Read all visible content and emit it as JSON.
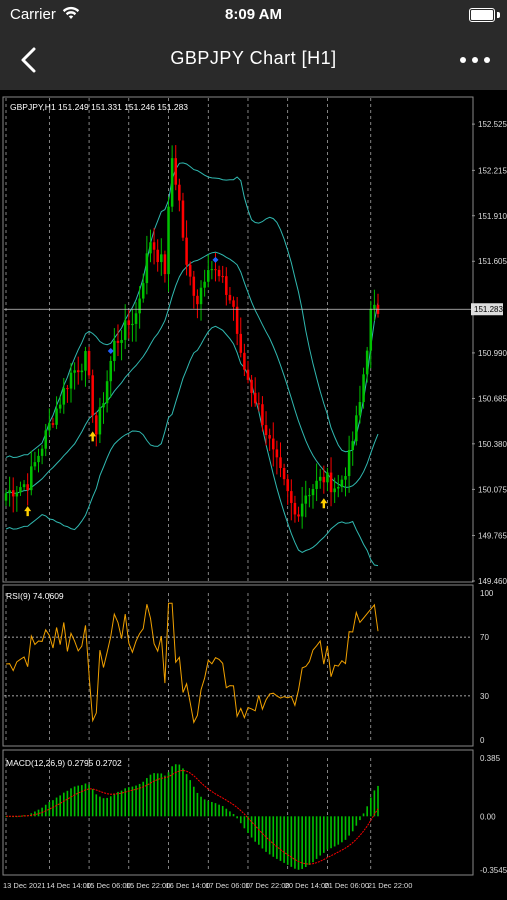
{
  "status_bar": {
    "carrier": "Carrier",
    "time": "8:09 AM"
  },
  "nav": {
    "title": "GBPJPY Chart [H1]"
  },
  "chart_data": [
    {
      "type": "candlestick",
      "title": "GBPJPY,H1  151.249 151.331 151.246 151.283",
      "price_ticks": [
        "152.525",
        "152.215",
        "151.910",
        "151.605",
        "150.990",
        "150.685",
        "150.380",
        "150.075",
        "149.765",
        "149.460"
      ],
      "price_tick_values": [
        152.525,
        152.215,
        151.91,
        151.605,
        150.99,
        150.685,
        150.38,
        150.075,
        149.765,
        149.46
      ],
      "current_price_label": "151.283",
      "current_price": 151.283,
      "ylim": [
        149.46,
        152.7
      ],
      "candles_hint": "~105 hourly bars with Bollinger bands and arrow signals"
    },
    {
      "type": "line",
      "title": "RSI(9) 74.0609",
      "ticks": [
        "100",
        "70",
        "30",
        "0"
      ],
      "tick_values": [
        100,
        70,
        30,
        0
      ],
      "levels": [
        70,
        30
      ],
      "ylim": [
        0,
        100
      ]
    },
    {
      "type": "bar",
      "title": "MACD(12,26,9) 0.2795 0.2702",
      "ticks": [
        "0.385",
        "0.00",
        "-0.3545"
      ],
      "tick_values": [
        0.385,
        0.0,
        -0.3545
      ],
      "ylim": [
        -0.3545,
        0.385
      ]
    }
  ],
  "x_labels": [
    "13 Dec 2021",
    "14 Dec 14:00",
    "15 Dec 06:00",
    "15 Dec 22:00",
    "16 Dec 14:00",
    "17 Dec 06:00",
    "17 Dec 22:00",
    "20 Dec 14:00",
    "21 Dec 06:00",
    "21 Dec 22:00"
  ],
  "colors": {
    "up": "#00c000",
    "down": "#ff0000",
    "bands": "#30b8b0",
    "rsi": "#f0a000",
    "macd_hist": "#00c000",
    "macd_signal": "#ff0000",
    "grid": "#ffffff"
  }
}
